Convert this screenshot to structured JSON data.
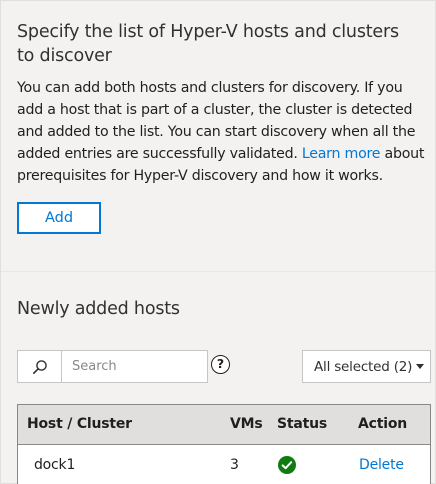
{
  "discovery": {
    "heading": "Specify the list of Hyper-V hosts and clusters to discover",
    "description_before_link": "You can add both hosts and clusters for discovery. If you add a host that is part of a cluster, the cluster is detected and added to the list. You can start discovery when all the added entries are successfully validated. ",
    "learn_more_link": "Learn more",
    "description_after_link": " about prerequisites for Hyper-V discovery and how it works.",
    "add_button": "Add"
  },
  "hosts": {
    "heading": "Newly added hosts",
    "search": {
      "placeholder": "Search",
      "icon": "search-icon"
    },
    "help": {
      "icon": "help-icon",
      "glyph": "?"
    },
    "filter": {
      "selected": "All selected (2)",
      "icon": "chevron-down-icon"
    },
    "table": {
      "columns": [
        "Host / Cluster",
        "VMs",
        "Status",
        "Action"
      ],
      "rows": [
        {
          "host": "dock1",
          "vms": "3",
          "status": "success",
          "status_icon": "check-circle-icon",
          "action": "Delete"
        }
      ]
    }
  },
  "colors": {
    "accent": "#0078d4",
    "success": "#107c10",
    "panel_bg": "#f3f2f1",
    "table_header_bg": "#e1dfdd"
  }
}
